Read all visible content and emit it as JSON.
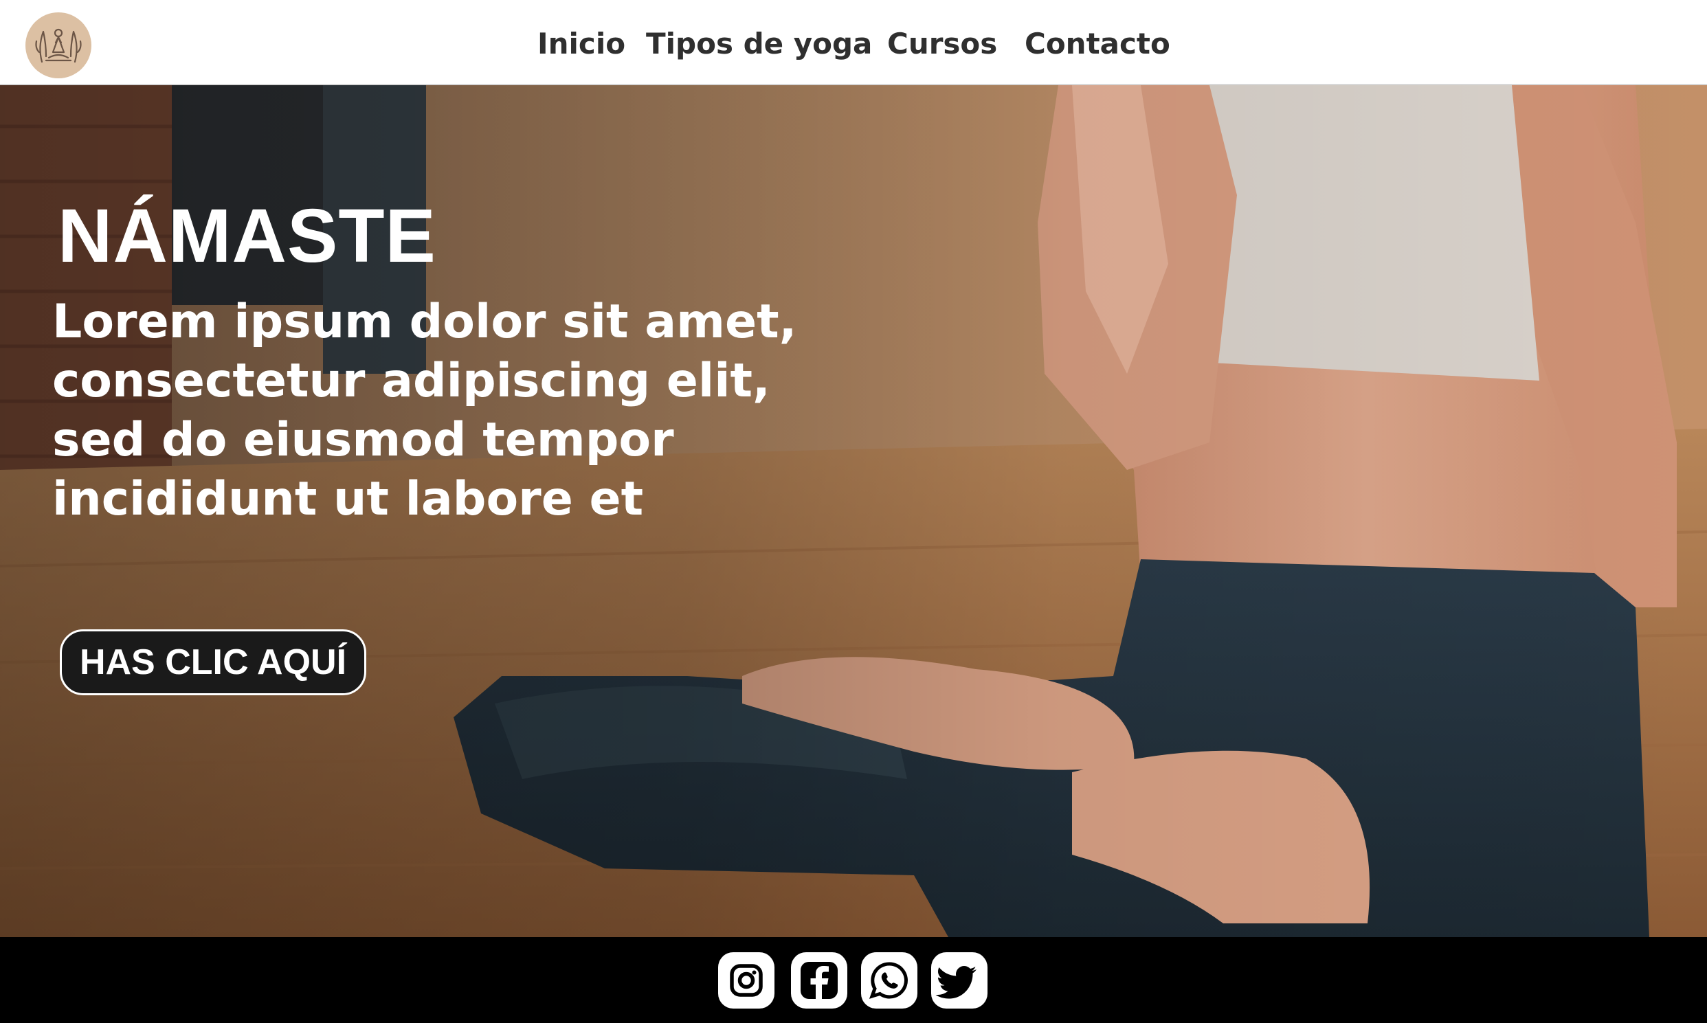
{
  "header": {
    "logo_icon": "meditating-figure-logo",
    "nav": [
      "Inicio",
      "Tipos de yoga",
      "Cursos",
      "Contacto"
    ]
  },
  "hero": {
    "title": "NÁMASTE",
    "text_lines": [
      "Lorem ipsum dolor sit amet,",
      "consectetur adipiscing elit,",
      "sed do eiusmod tempor",
      "incididunt ut labore et"
    ],
    "cta_label": "HAS CLIC AQUÍ",
    "image": "woman-seated-lotus-pose-hands-in-prayer"
  },
  "footer": {
    "social_icons": [
      "instagram-icon",
      "facebook-icon",
      "whatsapp-icon",
      "twitter-icon"
    ]
  },
  "colors": {
    "header_bg": "#ffffff",
    "nav_text": "#2f2f2f",
    "logo_bg": "#dcc0a3",
    "hero_text": "#ffffff",
    "cta_bg": "#1a1a1a",
    "footer_bg": "#000000",
    "icon_bg": "#ffffff"
  }
}
